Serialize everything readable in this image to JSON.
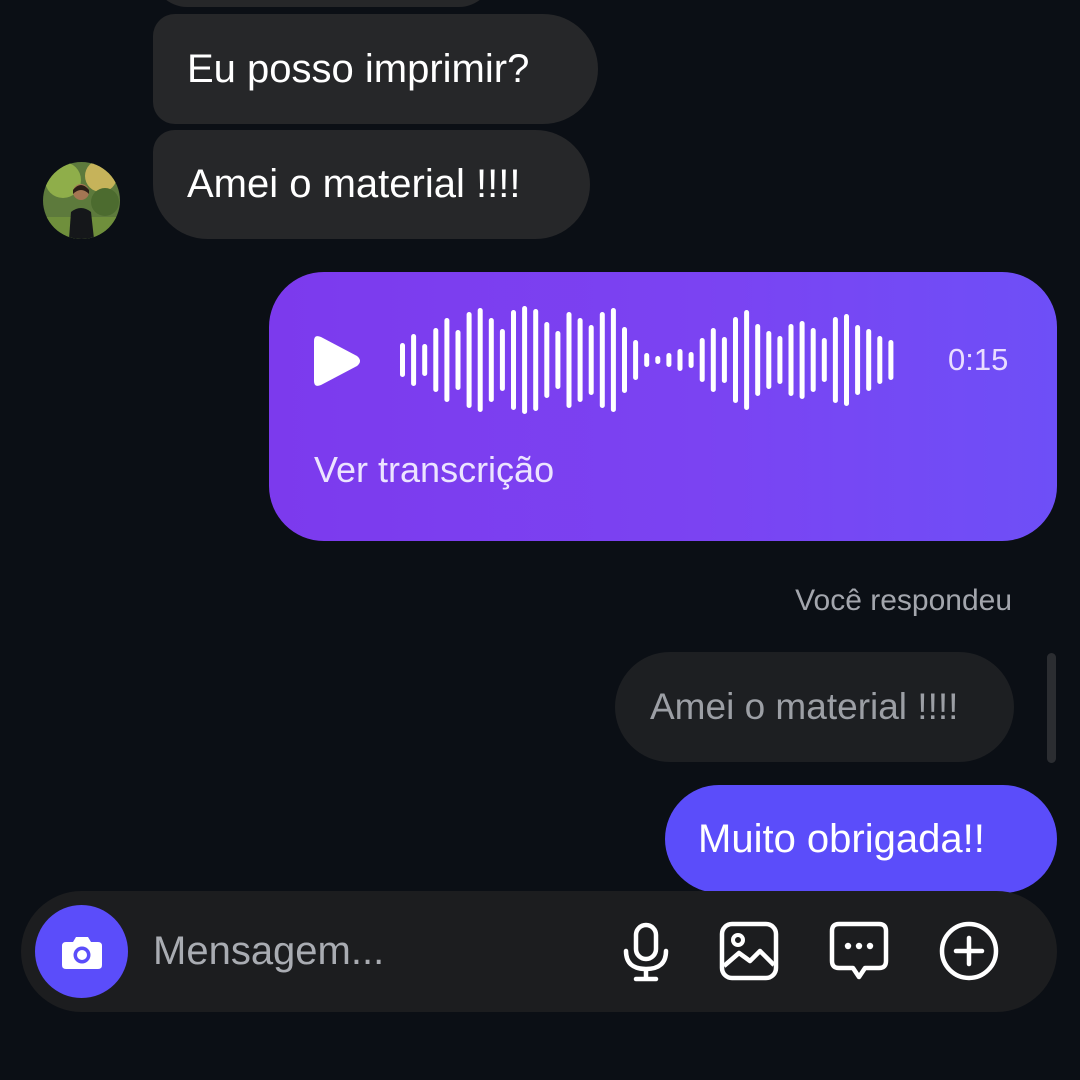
{
  "thread": {
    "partial_message": "",
    "message_1": "Eu posso imprimir?",
    "message_2": "Amei o material !!!!"
  },
  "voice_message": {
    "duration": "0:15",
    "transcript_link": "Ver transcrição",
    "accent": "#7c3aed",
    "icon": "play-icon"
  },
  "reply": {
    "label": "Você respondeu",
    "quoted_text": "Amei o material !!!!",
    "sent_text": "Muito obrigada!!",
    "accent": "#5b4dfa"
  },
  "composer": {
    "placeholder": "Mensagem...",
    "icons": [
      "camera-icon",
      "mic-icon",
      "gallery-icon",
      "sticker-icon",
      "plus-icon"
    ]
  }
}
